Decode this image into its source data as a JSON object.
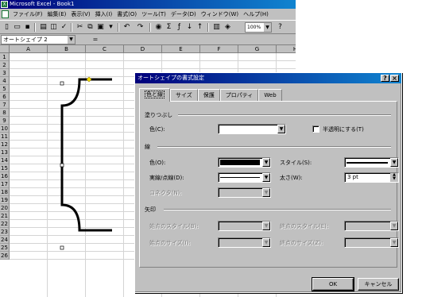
{
  "excel": {
    "title": "Microsoft Excel - Book1",
    "menu": [
      "ファイル(F)",
      "編集(E)",
      "表示(V)",
      "挿入(I)",
      "書式(O)",
      "ツール(T)",
      "データ(D)",
      "ウィンドウ(W)",
      "ヘルプ(H)"
    ],
    "zoom": "100%",
    "name_box": "オートシェイプ 2",
    "fx_label": "=",
    "columns": [
      "A",
      "B",
      "C",
      "D",
      "E",
      "F",
      "G",
      "H"
    ],
    "rows": [
      "1",
      "2",
      "3",
      "4",
      "5",
      "6",
      "7",
      "8",
      "9",
      "10",
      "11",
      "12",
      "13",
      "14",
      "15",
      "16",
      "17",
      "18",
      "19",
      "20",
      "21",
      "22",
      "23",
      "24",
      "25",
      "26"
    ],
    "toolbar_icons": [
      "new-icon",
      "open-icon",
      "save-icon",
      "print-icon",
      "preview-icon",
      "spell-icon",
      "cut-icon",
      "copy-icon",
      "paste-icon",
      "format-painter-icon",
      "undo-icon",
      "redo-icon",
      "hyperlink-icon",
      "autosum-icon",
      "function-icon",
      "sort-asc-icon",
      "sort-desc-icon",
      "chart-wizard-icon",
      "drawing-icon"
    ]
  },
  "dialog": {
    "title": "オートシェイプの書式設定",
    "help_label": "?",
    "close_label": "×",
    "tabs": [
      "色と線",
      "サイズ",
      "保護",
      "プロパティ",
      "Web"
    ],
    "fill": {
      "group_label": "塗りつぶし",
      "color_label": "色(C):",
      "color_value": "#ffffff",
      "semi_transparent_label": "半透明にする(T)"
    },
    "line": {
      "group_label": "線",
      "color_label": "色(O):",
      "color_value": "#000000",
      "dash_label": "実線/点線(D):",
      "connector_label": "コネクタ(N):",
      "style_label": "スタイル(S):",
      "weight_label": "太さ(W):",
      "weight_value": "3 pt"
    },
    "arrows": {
      "group_label": "矢印",
      "begin_style_label": "始点のスタイル(B):",
      "end_style_label": "終点のスタイル(E):",
      "begin_size_label": "始点のサイズ(I):",
      "end_size_label": "終点のサイズ(Z):"
    },
    "ok_label": "OK",
    "cancel_label": "キャンセル"
  }
}
